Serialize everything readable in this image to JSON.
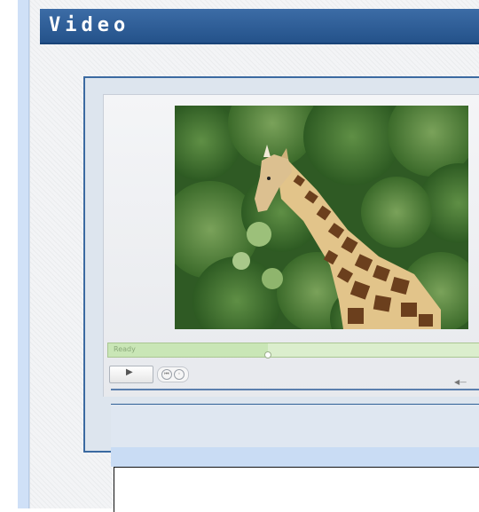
{
  "header": {
    "title": "Video"
  },
  "player": {
    "progress_label": "Ready",
    "progress_fraction": 0.43,
    "play_glyph": "▶",
    "rewind_glyph": "⏮",
    "pause_glyph": "◦",
    "volume_glyph": "◀—",
    "icons": {
      "play": "play-icon",
      "rewind": "rewind-icon",
      "volume": "volume-icon"
    }
  },
  "colors": {
    "header_bg": "#2d5c94",
    "frame_border": "#3b6aa1",
    "progress_bg": "#dbeecd"
  }
}
